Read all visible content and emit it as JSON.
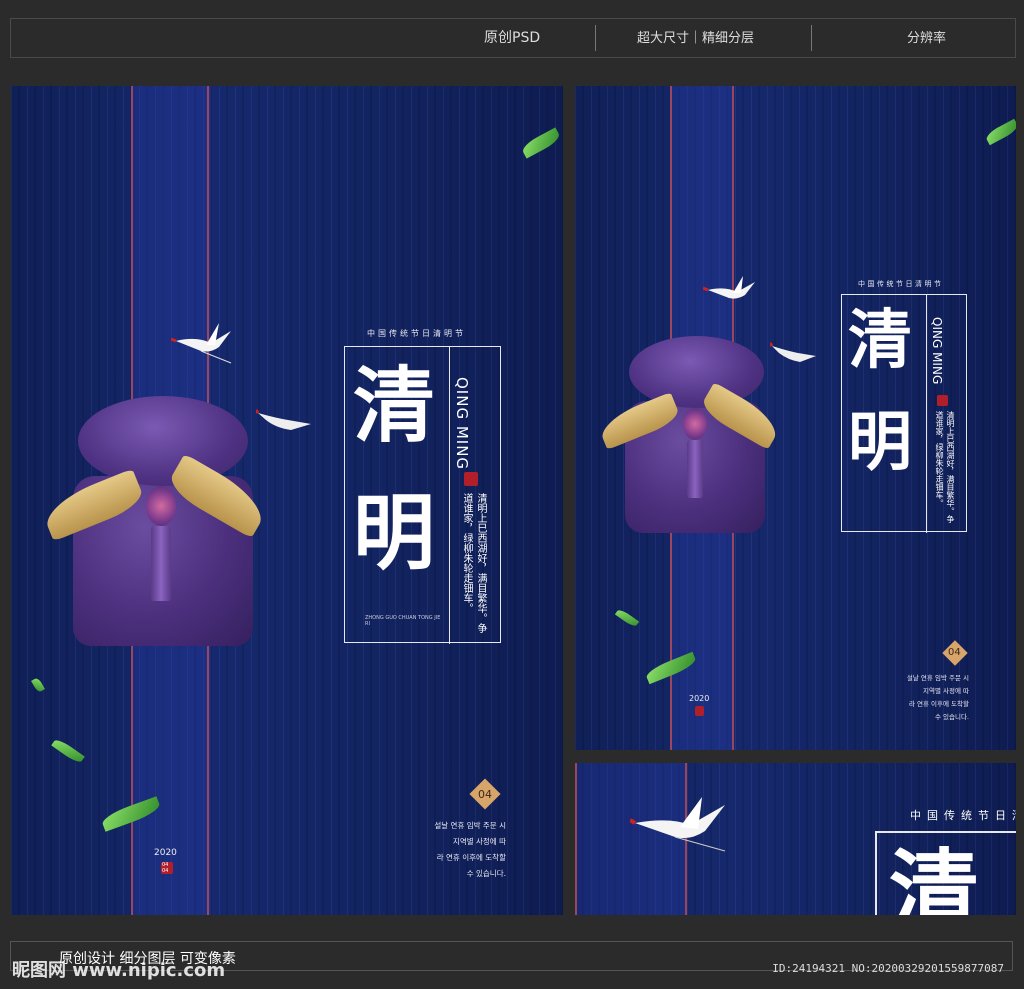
{
  "header": {
    "item1": "原创PSD",
    "item2": "超大尺寸｜精细分层",
    "item3": "分辨率"
  },
  "poster": {
    "subtitle": "中国传统节日清明节",
    "char1": "清",
    "char2": "明",
    "pinyin": "QING MING",
    "seal_text": "清明",
    "poem": "清明上巳西湖好，满目繁华。争道谁家，绿柳朱轮走钿车。",
    "tiny_caption": "ZHONG GUO CHUAN TONG JIE RI",
    "number": "04",
    "korean_lines": "설날 연휴 임박 주문 시\n지역별 사정에 따\n라 연휴 이후에 도착할\n수 있습니다.",
    "year": "2020",
    "day": "04 04"
  },
  "footer": {
    "text": "原创设计 细分图层 可变像素",
    "watermark": "昵图网 www.nipic.com",
    "id": "ID:24194321 NO:20200329201559877087"
  },
  "colors": {
    "background": "#2b2b2b",
    "poster_blue": "#16296e",
    "accent_gold": "#d7a46a",
    "seal_red": "#b11f2a"
  }
}
